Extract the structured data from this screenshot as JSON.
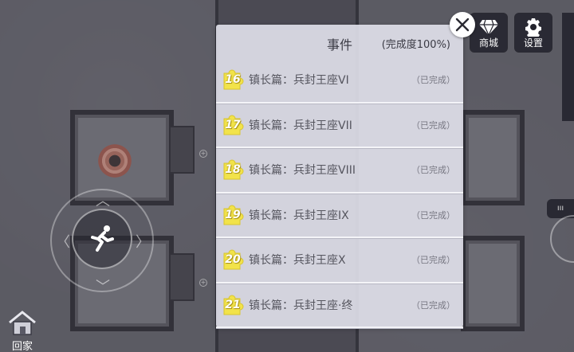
{
  "dialog": {
    "title": "事件",
    "progress": "(完成度100%)"
  },
  "events": [
    {
      "num": "16",
      "title": "镇长篇：兵封王座VI",
      "status": "（已完成）"
    },
    {
      "num": "17",
      "title": "镇长篇：兵封王座VII",
      "status": "（已完成）"
    },
    {
      "num": "18",
      "title": "镇长篇：兵封王座VIII",
      "status": "（已完成）"
    },
    {
      "num": "19",
      "title": "镇长篇：兵封王座IX",
      "status": "（已完成）"
    },
    {
      "num": "20",
      "title": "镇长篇：兵封王座X",
      "status": "（已完成）"
    },
    {
      "num": "21",
      "title": "镇长篇：兵封王座·终",
      "status": "（已完成）"
    }
  ],
  "top_buttons": {
    "shop": "商城",
    "settings": "设置"
  },
  "home": {
    "label": "回家"
  },
  "icons": {
    "shop": "diamond-icon",
    "settings": "gear-icon",
    "home": "house-icon",
    "close": "close-icon",
    "joystick": "running-man-icon",
    "badge": "puzzle-piece-icon"
  },
  "colors": {
    "badge_fill": "#f2e34a",
    "dialog_bg": "#e2e2ec",
    "overlay_btn": "#23232d"
  }
}
